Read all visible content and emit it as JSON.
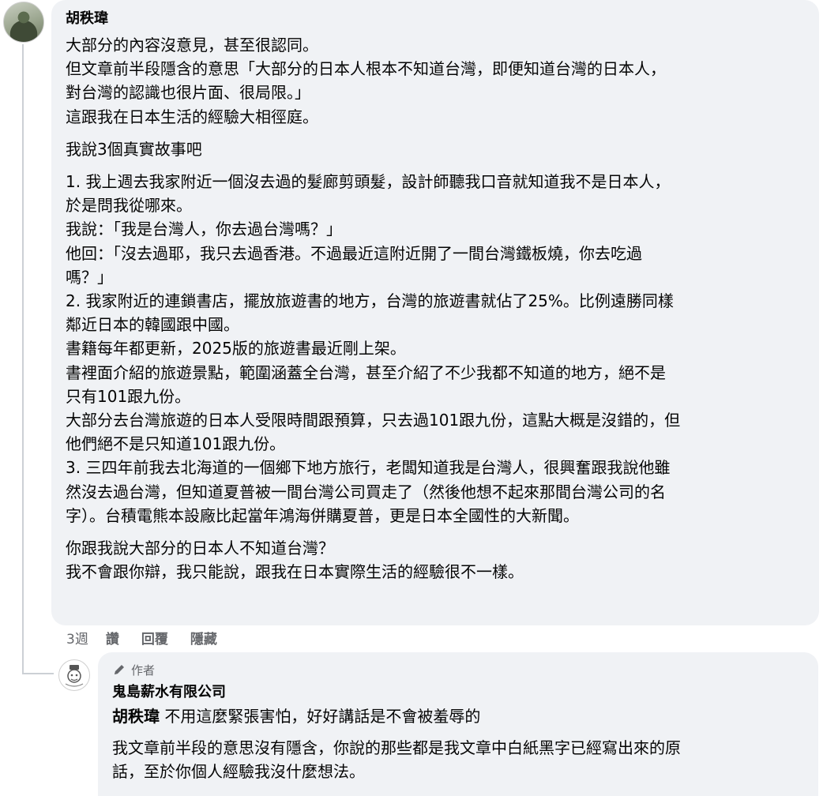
{
  "main_comment": {
    "author": "胡秩瑋",
    "paragraphs": [
      [
        "大部分的內容沒意見，甚至很認同。",
        "但文章前半段隱含的意思「大部分的日本人根本不知道台灣，即便知道台灣的日本人，",
        "對台灣的認識也很片面、很局限。」",
        "這跟我在日本生活的經驗大相徑庭。"
      ],
      [
        "我說3個真實故事吧"
      ],
      [
        "1. 我上週去我家附近一個沒去過的髮廊剪頭髮，設計師聽我口音就知道我不是日本人，",
        "於是問我從哪來。",
        "我說：「我是台灣人，你去過台灣嗎？」",
        "他回：「沒去過耶，我只去過香港。不過最近這附近開了一間台灣鐵板燒，你去吃過",
        "嗎？」",
        "2. 我家附近的連鎖書店，擺放旅遊書的地方，台灣的旅遊書就佔了25%。比例遠勝同樣",
        "鄰近日本的韓國跟中國。",
        "書籍每年都更新，2025版的旅遊書最近剛上架。",
        "書裡面介紹的旅遊景點，範圍涵蓋全台灣，甚至介紹了不少我都不知道的地方，絕不是",
        "只有101跟九份。",
        "大部分去台灣旅遊的日本人受限時間跟預算，只去過101跟九份，這點大概是沒錯的，但",
        "他們絕不是只知道101跟九份。",
        "3. 三四年前我去北海道的一個鄉下地方旅行，老闆知道我是台灣人，很興奮跟我說他雖",
        "然沒去過台灣，但知道夏普被一間台灣公司買走了（然後他想不起來那間台灣公司的名",
        "字）。台積電熊本設廠比起當年鴻海併購夏普，更是日本全國性的大新聞。"
      ],
      [
        "你跟我說大部分的日本人不知道台灣？",
        "我不會跟你辯，我只能說，跟我在日本實際生活的經驗很不一樣。"
      ]
    ],
    "actions": {
      "time": "3週",
      "like": "讚",
      "reply": "回覆",
      "hide": "隱藏"
    }
  },
  "reply_comment": {
    "badge": "作者",
    "author": "鬼島薪水有限公司",
    "mention": "胡秩瑋",
    "first_line": "不用這麼緊張害怕，好好講話是不會被羞辱的",
    "paragraph": [
      "我文章前半段的意思沒有隱含，你說的那些都是我文章中白紙黑字已經寫出來的原",
      "話，至於你個人經驗我沒什麼想法。"
    ]
  }
}
